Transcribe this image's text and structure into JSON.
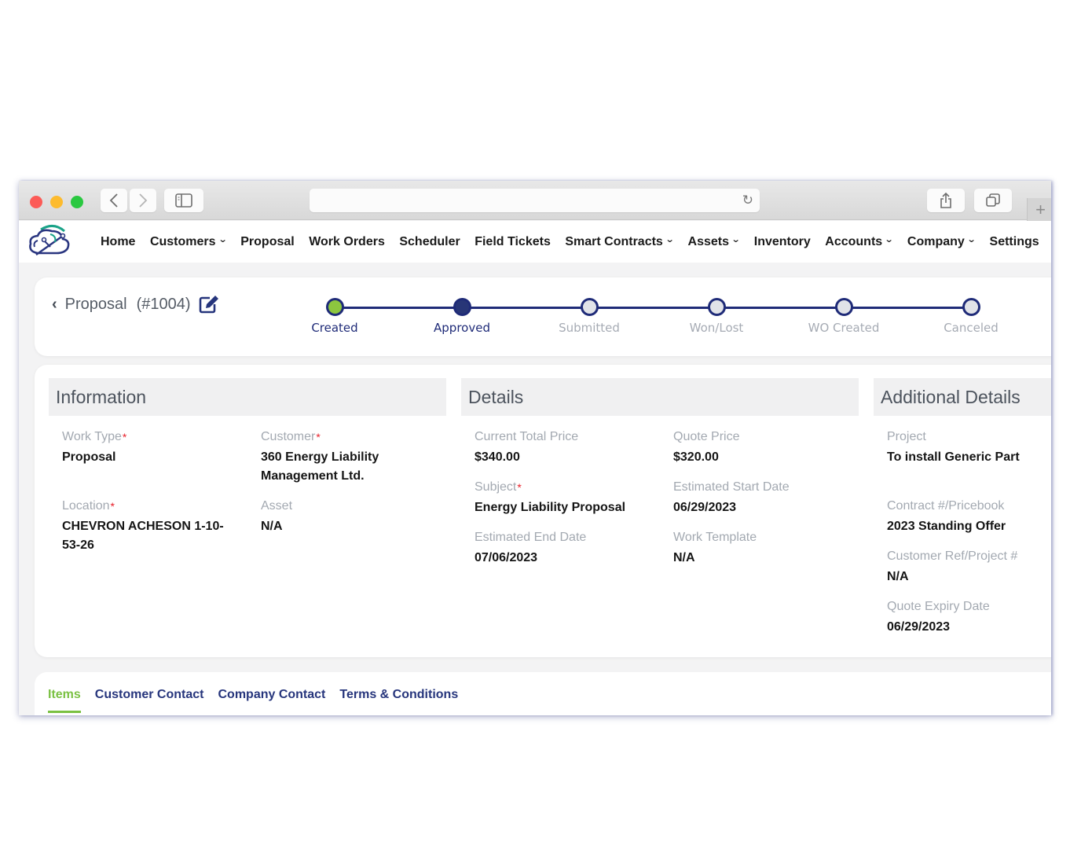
{
  "browser": {
    "back_icon": "chevron-left-icon",
    "forward_icon": "chevron-right-icon",
    "sidebar_icon": "sidebar-icon",
    "reload_icon": "reload-icon",
    "share_icon": "share-icon",
    "tabs_icon": "tabs-overview-icon",
    "new_tab_label": "+"
  },
  "nav": {
    "items": [
      {
        "label": "Home",
        "dropdown": false
      },
      {
        "label": "Customers",
        "dropdown": true
      },
      {
        "label": "Proposal",
        "dropdown": false
      },
      {
        "label": "Work Orders",
        "dropdown": false
      },
      {
        "label": "Scheduler",
        "dropdown": false
      },
      {
        "label": "Field Tickets",
        "dropdown": false
      },
      {
        "label": "Smart Contracts",
        "dropdown": true
      },
      {
        "label": "Assets",
        "dropdown": true
      },
      {
        "label": "Inventory",
        "dropdown": false
      },
      {
        "label": "Accounts",
        "dropdown": true
      },
      {
        "label": "Company",
        "dropdown": true
      },
      {
        "label": "Settings",
        "dropdown": false
      }
    ]
  },
  "header": {
    "title": "Proposal",
    "number": "(#1004)",
    "steps": [
      {
        "label": "Created",
        "state": "done"
      },
      {
        "label": "Approved",
        "state": "current"
      },
      {
        "label": "Submitted",
        "state": "pending"
      },
      {
        "label": "Won/Lost",
        "state": "pending"
      },
      {
        "label": "WO Created",
        "state": "pending"
      },
      {
        "label": "Canceled",
        "state": "pending"
      }
    ]
  },
  "information": {
    "title": "Information",
    "work_type": {
      "label": "Work Type",
      "value": "Proposal",
      "required": true
    },
    "customer": {
      "label": "Customer",
      "value": "360 Energy Liability Management Ltd.",
      "required": true
    },
    "location": {
      "label": "Location",
      "value": "CHEVRON ACHESON 1-10-53-26",
      "required": true
    },
    "asset": {
      "label": "Asset",
      "value": "N/A",
      "required": false
    }
  },
  "details": {
    "title": "Details",
    "current_total_price": {
      "label": "Current Total Price",
      "value": "$340.00"
    },
    "quote_price": {
      "label": "Quote Price",
      "value": "$320.00"
    },
    "subject": {
      "label": "Subject",
      "value": "Energy Liability Proposal",
      "required": true
    },
    "est_start": {
      "label": "Estimated Start Date",
      "value": "06/29/2023"
    },
    "est_end": {
      "label": "Estimated End Date",
      "value": "07/06/2023"
    },
    "work_template": {
      "label": "Work Template",
      "value": "N/A"
    }
  },
  "additional": {
    "title": "Additional Details",
    "project": {
      "label": "Project",
      "value": "To install Generic Part"
    },
    "contract": {
      "label": "Contract #/Pricebook",
      "value": "2023 Standing Offer"
    },
    "customer_ref": {
      "label": "Customer Ref/Project #",
      "value": "N/A"
    },
    "quote_expiry": {
      "label": "Quote Expiry Date",
      "value": "06/29/2023"
    }
  },
  "tabs": [
    {
      "label": "Items",
      "active": true
    },
    {
      "label": "Customer Contact",
      "active": false
    },
    {
      "label": "Company Contact",
      "active": false
    },
    {
      "label": "Terms & Conditions",
      "active": false
    }
  ],
  "colors": {
    "brand_navy": "#1f2b78",
    "accent_green": "#7ac142",
    "required_red": "#e8202a"
  }
}
